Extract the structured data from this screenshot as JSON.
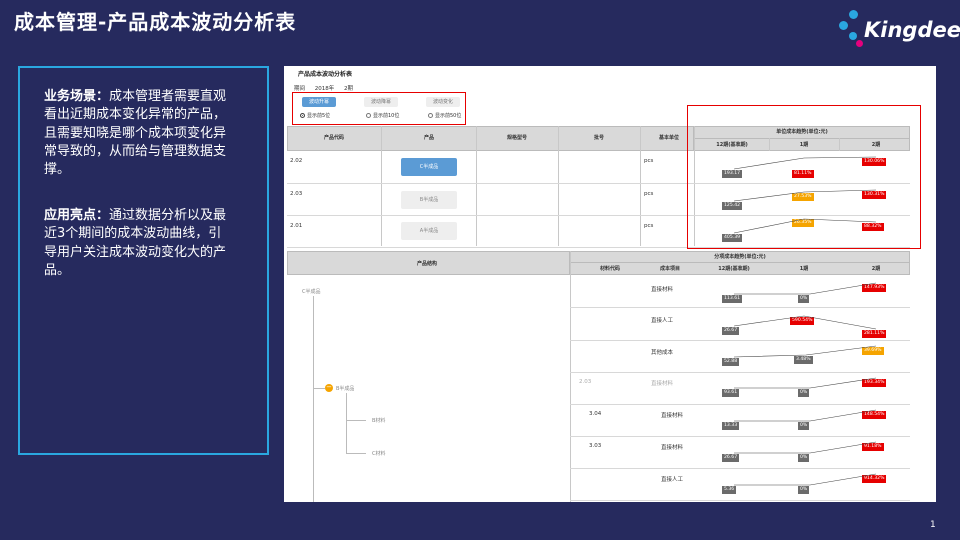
{
  "page": {
    "title": "成本管理-产品成本波动分析表",
    "page_number": "1",
    "brand": "Kingdee",
    "brand_colors": {
      "cyan": "#2aa7e0",
      "magenta": "#e5007e",
      "white": "#ffffff"
    }
  },
  "left_panel": {
    "p1_label": "业务场景：",
    "p1_text": "成本管理者需要直观看出近期成本变化异常的产品，且需要知晓是哪个成本项变化异常导致的，从而给与管理数据支撑。",
    "p2_label": "应用亮点：",
    "p2_text": "通过数据分析以及最近3个期间的成本波动曲线，引导用户关注成本波动变化大的产品。"
  },
  "report": {
    "title": "产品成本波动分析表",
    "period_label": "期间",
    "period_value": "2018年",
    "period_num": "2期",
    "buttons": [
      "波动升幂",
      "波动降幂",
      "波动变化"
    ],
    "active_button": 0,
    "radios": [
      "显示前5位",
      "显示前10位",
      "显示前50位"
    ],
    "radio_selected": 0,
    "top_table": {
      "headers": [
        "产品代码",
        "产品",
        "规格型号",
        "批号",
        "基本单位"
      ],
      "trend_header": "单位成本趋势(单位:元)",
      "periods": [
        "12期(基准期)",
        "1期",
        "2期"
      ],
      "rows": [
        {
          "code": "2.02",
          "product": "C半成品",
          "unit": "pcs",
          "base": "193.17",
          "p1": "81.11%",
          "p2": "130.06%",
          "p1_color": "red",
          "p2_color": "red",
          "selected": true
        },
        {
          "code": "2.03",
          "product": "B半成品",
          "unit": "pcs",
          "base": "125.42",
          "p1": "27.53%",
          "p2": "130.31%",
          "p1_color": "orange",
          "p2_color": "red",
          "selected": false
        },
        {
          "code": "2.01",
          "product": "A半成品",
          "unit": "pcs",
          "base": "405.39",
          "p1": "26.35%",
          "p2": "88.32%",
          "p1_color": "orange",
          "p2_color": "red",
          "selected": false
        }
      ]
    },
    "bottom_table": {
      "structure_header": "产品结构",
      "trend_header": "分项成本趋势(单位:元)",
      "cols": [
        "材料代码",
        "成本项目",
        "12期(基准期)",
        "1期",
        "2期"
      ],
      "tree": {
        "root": "C半成品",
        "child": "B半成品",
        "leaf1": "B材料",
        "leaf2": "C材料"
      },
      "rows": [
        {
          "code": "",
          "item": "直接材料",
          "base": "113.61",
          "p1": "0%",
          "p2": "147.93%",
          "p1_color": "gray",
          "p2_color": "red"
        },
        {
          "code": "",
          "item": "直接人工",
          "base": "26.67",
          "p1": "590.54%",
          "p2": "281.11%",
          "p1_color": "red",
          "p2_color": "red"
        },
        {
          "code": "",
          "item": "其他成本",
          "base": "52.88",
          "p1": "3.48%",
          "p2": "39.69%",
          "p1_color": "gray",
          "p2_color": "orange"
        },
        {
          "code": "2.03",
          "item": "直接材料",
          "base": "93.61",
          "p1": "0%",
          "p2": "193.34%",
          "p1_color": "gray",
          "p2_color": "red",
          "muted": true
        },
        {
          "code": "3.04",
          "item": "直接材料",
          "base": "13.33",
          "p1": "0%",
          "p2": "148.54%",
          "p1_color": "gray",
          "p2_color": "red"
        },
        {
          "code": "3.03",
          "item": "直接材料",
          "base": "26.67",
          "p1": "0%",
          "p2": "91.18%",
          "p1_color": "gray",
          "p2_color": "red"
        },
        {
          "code": "",
          "item": "直接人工",
          "base": "5.36",
          "p1": "0%",
          "p2": "914.32%",
          "p1_color": "gray",
          "p2_color": "red"
        }
      ]
    }
  }
}
